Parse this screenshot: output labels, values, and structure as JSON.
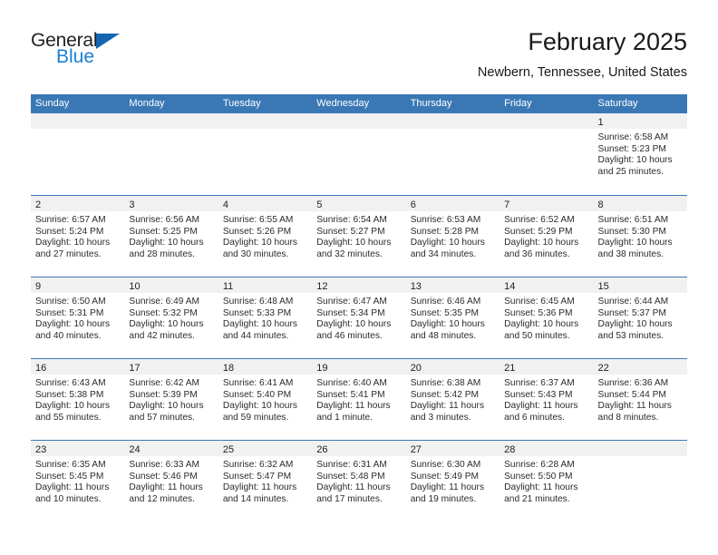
{
  "brand": {
    "name_part1": "General",
    "name_part2": "Blue",
    "accent_color": "#1a7fd4",
    "triangle_color": "#1565b0"
  },
  "header": {
    "title": "February 2025",
    "subtitle": "Newbern, Tennessee, United States"
  },
  "theme": {
    "header_blue": "#3a78b5",
    "day_band_gray": "#f1f1f1",
    "text": "#1a1a1a"
  },
  "weekdays": [
    "Sunday",
    "Monday",
    "Tuesday",
    "Wednesday",
    "Thursday",
    "Friday",
    "Saturday"
  ],
  "weeks": [
    [
      {
        "day": "",
        "lines": []
      },
      {
        "day": "",
        "lines": []
      },
      {
        "day": "",
        "lines": []
      },
      {
        "day": "",
        "lines": []
      },
      {
        "day": "",
        "lines": []
      },
      {
        "day": "",
        "lines": []
      },
      {
        "day": "1",
        "lines": [
          "Sunrise: 6:58 AM",
          "Sunset: 5:23 PM",
          "Daylight: 10 hours",
          "and 25 minutes."
        ]
      }
    ],
    [
      {
        "day": "2",
        "lines": [
          "Sunrise: 6:57 AM",
          "Sunset: 5:24 PM",
          "Daylight: 10 hours",
          "and 27 minutes."
        ]
      },
      {
        "day": "3",
        "lines": [
          "Sunrise: 6:56 AM",
          "Sunset: 5:25 PM",
          "Daylight: 10 hours",
          "and 28 minutes."
        ]
      },
      {
        "day": "4",
        "lines": [
          "Sunrise: 6:55 AM",
          "Sunset: 5:26 PM",
          "Daylight: 10 hours",
          "and 30 minutes."
        ]
      },
      {
        "day": "5",
        "lines": [
          "Sunrise: 6:54 AM",
          "Sunset: 5:27 PM",
          "Daylight: 10 hours",
          "and 32 minutes."
        ]
      },
      {
        "day": "6",
        "lines": [
          "Sunrise: 6:53 AM",
          "Sunset: 5:28 PM",
          "Daylight: 10 hours",
          "and 34 minutes."
        ]
      },
      {
        "day": "7",
        "lines": [
          "Sunrise: 6:52 AM",
          "Sunset: 5:29 PM",
          "Daylight: 10 hours",
          "and 36 minutes."
        ]
      },
      {
        "day": "8",
        "lines": [
          "Sunrise: 6:51 AM",
          "Sunset: 5:30 PM",
          "Daylight: 10 hours",
          "and 38 minutes."
        ]
      }
    ],
    [
      {
        "day": "9",
        "lines": [
          "Sunrise: 6:50 AM",
          "Sunset: 5:31 PM",
          "Daylight: 10 hours",
          "and 40 minutes."
        ]
      },
      {
        "day": "10",
        "lines": [
          "Sunrise: 6:49 AM",
          "Sunset: 5:32 PM",
          "Daylight: 10 hours",
          "and 42 minutes."
        ]
      },
      {
        "day": "11",
        "lines": [
          "Sunrise: 6:48 AM",
          "Sunset: 5:33 PM",
          "Daylight: 10 hours",
          "and 44 minutes."
        ]
      },
      {
        "day": "12",
        "lines": [
          "Sunrise: 6:47 AM",
          "Sunset: 5:34 PM",
          "Daylight: 10 hours",
          "and 46 minutes."
        ]
      },
      {
        "day": "13",
        "lines": [
          "Sunrise: 6:46 AM",
          "Sunset: 5:35 PM",
          "Daylight: 10 hours",
          "and 48 minutes."
        ]
      },
      {
        "day": "14",
        "lines": [
          "Sunrise: 6:45 AM",
          "Sunset: 5:36 PM",
          "Daylight: 10 hours",
          "and 50 minutes."
        ]
      },
      {
        "day": "15",
        "lines": [
          "Sunrise: 6:44 AM",
          "Sunset: 5:37 PM",
          "Daylight: 10 hours",
          "and 53 minutes."
        ]
      }
    ],
    [
      {
        "day": "16",
        "lines": [
          "Sunrise: 6:43 AM",
          "Sunset: 5:38 PM",
          "Daylight: 10 hours",
          "and 55 minutes."
        ]
      },
      {
        "day": "17",
        "lines": [
          "Sunrise: 6:42 AM",
          "Sunset: 5:39 PM",
          "Daylight: 10 hours",
          "and 57 minutes."
        ]
      },
      {
        "day": "18",
        "lines": [
          "Sunrise: 6:41 AM",
          "Sunset: 5:40 PM",
          "Daylight: 10 hours",
          "and 59 minutes."
        ]
      },
      {
        "day": "19",
        "lines": [
          "Sunrise: 6:40 AM",
          "Sunset: 5:41 PM",
          "Daylight: 11 hours",
          "and 1 minute."
        ]
      },
      {
        "day": "20",
        "lines": [
          "Sunrise: 6:38 AM",
          "Sunset: 5:42 PM",
          "Daylight: 11 hours",
          "and 3 minutes."
        ]
      },
      {
        "day": "21",
        "lines": [
          "Sunrise: 6:37 AM",
          "Sunset: 5:43 PM",
          "Daylight: 11 hours",
          "and 6 minutes."
        ]
      },
      {
        "day": "22",
        "lines": [
          "Sunrise: 6:36 AM",
          "Sunset: 5:44 PM",
          "Daylight: 11 hours",
          "and 8 minutes."
        ]
      }
    ],
    [
      {
        "day": "23",
        "lines": [
          "Sunrise: 6:35 AM",
          "Sunset: 5:45 PM",
          "Daylight: 11 hours",
          "and 10 minutes."
        ]
      },
      {
        "day": "24",
        "lines": [
          "Sunrise: 6:33 AM",
          "Sunset: 5:46 PM",
          "Daylight: 11 hours",
          "and 12 minutes."
        ]
      },
      {
        "day": "25",
        "lines": [
          "Sunrise: 6:32 AM",
          "Sunset: 5:47 PM",
          "Daylight: 11 hours",
          "and 14 minutes."
        ]
      },
      {
        "day": "26",
        "lines": [
          "Sunrise: 6:31 AM",
          "Sunset: 5:48 PM",
          "Daylight: 11 hours",
          "and 17 minutes."
        ]
      },
      {
        "day": "27",
        "lines": [
          "Sunrise: 6:30 AM",
          "Sunset: 5:49 PM",
          "Daylight: 11 hours",
          "and 19 minutes."
        ]
      },
      {
        "day": "28",
        "lines": [
          "Sunrise: 6:28 AM",
          "Sunset: 5:50 PM",
          "Daylight: 11 hours",
          "and 21 minutes."
        ]
      },
      {
        "day": "",
        "lines": []
      }
    ]
  ]
}
